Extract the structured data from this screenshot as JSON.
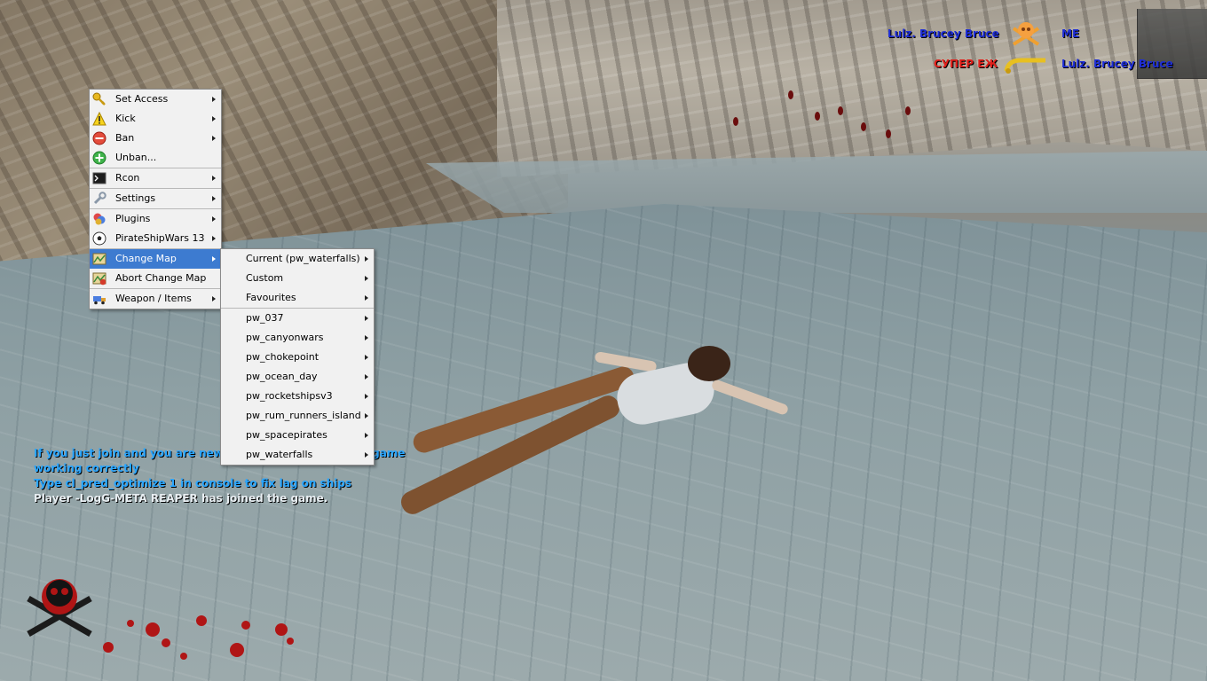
{
  "killfeed": [
    {
      "left": "Lulz. Brucey Bruce",
      "left_color": "#1e2ed6",
      "icon": "skull-crossbones-icon",
      "right": "ME",
      "right_color": "#1e2ed6"
    },
    {
      "left": "СУПЕР ЕЖ",
      "left_color": "#e0201b",
      "icon": "golden-sword-icon",
      "right": "Lulz. Brucey Bruce",
      "right_color": "#1e2ed6"
    }
  ],
  "chat": [
    {
      "text": "If you just join and you are new to pirate ship wars, the game",
      "color": "#2aa6ff"
    },
    {
      "text": "working correctly",
      "color": "#2aa6ff"
    },
    {
      "text": "Type cl_pred_optimize 1 in console to fix lag on ships",
      "color": "#2aa6ff"
    },
    {
      "text": "Player -LogG-META REAPER has joined the game.",
      "color": "#e8eef2"
    }
  ],
  "menu": {
    "groups": [
      [
        {
          "label": "Set Access",
          "icon": "key-icon",
          "arrow": true
        },
        {
          "label": "Kick",
          "icon": "warning-icon",
          "arrow": true
        },
        {
          "label": "Ban",
          "icon": "ban-icon",
          "arrow": true
        },
        {
          "label": "Unban...",
          "icon": "add-icon",
          "arrow": false
        }
      ],
      [
        {
          "label": "Rcon",
          "icon": "console-icon",
          "arrow": true
        }
      ],
      [
        {
          "label": "Settings",
          "icon": "wrench-icon",
          "arrow": true
        }
      ],
      [
        {
          "label": "Plugins",
          "icon": "plugin-icon",
          "arrow": true
        },
        {
          "label": "PirateShipWars 13",
          "icon": "ball-icon",
          "arrow": true
        }
      ],
      [
        {
          "label": "Change Map",
          "icon": "map-icon",
          "arrow": true,
          "highlighted": true
        },
        {
          "label": "Abort Change Map",
          "icon": "map-abort-icon",
          "arrow": false
        }
      ],
      [
        {
          "label": "Weapon / Items",
          "icon": "truck-icon",
          "arrow": true
        }
      ]
    ]
  },
  "submenu": {
    "top": [
      {
        "label": "Current (pw_waterfalls)"
      },
      {
        "label": "Custom"
      },
      {
        "label": "Favourites"
      }
    ],
    "maps": [
      {
        "label": "pw_037"
      },
      {
        "label": "pw_canyonwars"
      },
      {
        "label": "pw_chokepoint"
      },
      {
        "label": "pw_ocean_day"
      },
      {
        "label": "pw_rocketshipsv3"
      },
      {
        "label": "pw_rum_runners_island"
      },
      {
        "label": "pw_spacepirates"
      },
      {
        "label": "pw_waterfalls"
      }
    ]
  },
  "colors": {
    "menu_highlight": "#3d7bd0",
    "menu_bg": "#f1f1f1"
  }
}
